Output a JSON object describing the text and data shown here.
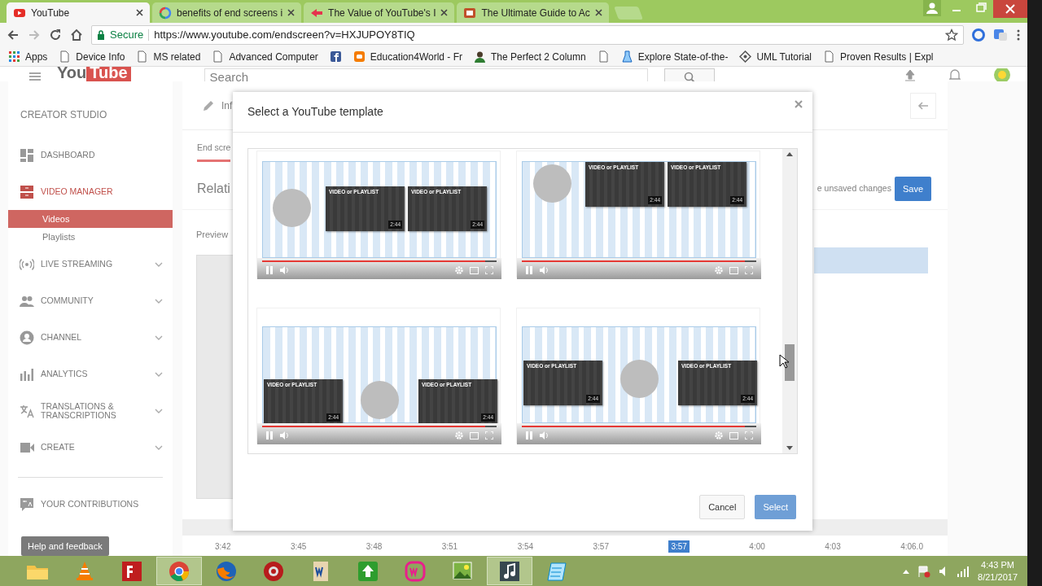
{
  "browser": {
    "tabs": [
      {
        "title": "YouTube",
        "selected": true
      },
      {
        "title": "benefits of end screens i",
        "selected": false
      },
      {
        "title": "The Value of YouTube's I",
        "selected": false
      },
      {
        "title": "The Ultimate Guide to Ac",
        "selected": false
      }
    ],
    "secure_label": "Secure",
    "url": "https://www.youtube.com/endscreen?v=HXJUPOY8TIQ",
    "bookmarks": [
      {
        "label": "Apps"
      },
      {
        "label": "Device Info"
      },
      {
        "label": "MS related"
      },
      {
        "label": "Advanced Computer"
      },
      {
        "kind": "icon"
      },
      {
        "label": "Education4World - Fr"
      },
      {
        "label": "The Perfect 2 Column"
      },
      {
        "kind": "icon"
      },
      {
        "label": "Explore State-of-the-"
      },
      {
        "label": "UML Tutorial"
      },
      {
        "label": "Proven Results | Expl"
      }
    ]
  },
  "studio": {
    "logo": {
      "left": "You",
      "right": "Tube"
    },
    "search_placeholder": "Search",
    "sidebar": {
      "title": "CREATOR STUDIO",
      "items": [
        {
          "label": "DASHBOARD",
          "selected": false
        },
        {
          "label": "VIDEO MANAGER",
          "selected": true,
          "expanded": true,
          "children": [
            {
              "label": "Videos",
              "selected": true
            },
            {
              "label": "Playlists",
              "selected": false
            }
          ]
        },
        {
          "label": "LIVE STREAMING",
          "selected": false,
          "expanded": false
        },
        {
          "label": "COMMUNITY",
          "selected": false,
          "expanded": false
        },
        {
          "label": "CHANNEL",
          "selected": false,
          "expanded": false
        },
        {
          "label": "ANALYTICS",
          "selected": false,
          "expanded": false
        },
        {
          "label": "TRANSLATIONS & TRANSCRIPTIONS",
          "selected": false,
          "expanded": false
        },
        {
          "label": "CREATE",
          "selected": false,
          "expanded": false
        }
      ],
      "contributions": "YOUR CONTRIBUTIONS",
      "help_button": "Help and feedback"
    },
    "editor": {
      "info_tab": "Inf",
      "end_screen_tab": {
        "label": "End scre",
        "selected": true
      },
      "heading": "Relati",
      "preview_label": "Preview",
      "unsaved_text": "e unsaved changes",
      "save_button": "Save",
      "timeline": [
        {
          "label": "3:42",
          "selected": false
        },
        {
          "label": "3:45",
          "selected": false
        },
        {
          "label": "3:48",
          "selected": false
        },
        {
          "label": "3:51",
          "selected": false
        },
        {
          "label": "3:54",
          "selected": false
        },
        {
          "label": "3:57",
          "selected": false
        },
        {
          "label": "3:57",
          "selected": true
        },
        {
          "label": "4:00",
          "selected": false
        },
        {
          "label": "4:03",
          "selected": false
        },
        {
          "label": "4:06.0",
          "selected": false
        }
      ]
    }
  },
  "modal": {
    "title": "Select a YouTube template",
    "templates": [
      {
        "kind": "right-pair-middle",
        "tiles": [
          {
            "label": "VIDEO or PLAYLIST",
            "duration": "2:44"
          },
          {
            "label": "VIDEO or PLAYLIST",
            "duration": "2:44"
          }
        ]
      },
      {
        "kind": "right-pair-top",
        "tiles": [
          {
            "label": "VIDEO or PLAYLIST",
            "duration": "2:44"
          },
          {
            "label": "VIDEO or PLAYLIST",
            "duration": "2:44"
          }
        ]
      },
      {
        "kind": "split-bottom",
        "tiles": [
          {
            "label": "VIDEO or PLAYLIST",
            "duration": "2:44"
          },
          {
            "label": "VIDEO or PLAYLIST",
            "duration": "2:44"
          }
        ]
      },
      {
        "kind": "split-middle",
        "tiles": [
          {
            "label": "VIDEO or PLAYLIST",
            "duration": "2:44"
          },
          {
            "label": "VIDEO or PLAYLIST",
            "duration": "2:44"
          }
        ]
      }
    ],
    "cancel_button": "Cancel",
    "select_button": {
      "label": "Select",
      "disabled": true
    }
  },
  "taskbar": {
    "apps": [
      {
        "active": false
      },
      {
        "active": false
      },
      {
        "active": false
      },
      {
        "active": true
      },
      {
        "active": false
      },
      {
        "active": false
      },
      {
        "active": false
      },
      {
        "active": false
      },
      {
        "active": false
      },
      {
        "active": false
      },
      {
        "active": true
      },
      {
        "active": false
      }
    ],
    "time": "4:43 PM",
    "date": "8/21/2017"
  }
}
